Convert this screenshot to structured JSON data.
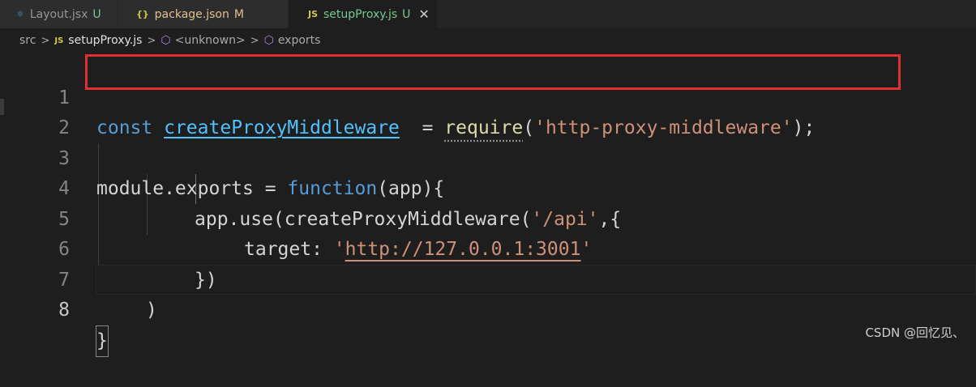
{
  "tabs": [
    {
      "icon_text": "⚛",
      "label": "Layout.jsx",
      "status": "U",
      "status_color": "#73c991"
    },
    {
      "icon_text": "{}",
      "label": "package.json",
      "status": "M",
      "status_color": "#e2c08d"
    },
    {
      "icon_text": "JS",
      "label": "setupProxy.js",
      "status": "U",
      "status_color": "#73c991",
      "active": true,
      "close": "✕"
    }
  ],
  "breadcrumb": {
    "folder": "src",
    "file_icon": "JS",
    "file": "setupProxy.js",
    "item1": "<unknown>",
    "item2": "exports"
  },
  "editor": {
    "line_numbers": [
      "1",
      "2",
      "3",
      "4",
      "5",
      "6",
      "7",
      "8"
    ],
    "current_line": "8",
    "lines": {
      "l1": {
        "kw": "const",
        "name": "createProxyMiddleware",
        "eq": "  = ",
        "req": "require",
        "open": "(",
        "str": "'http-proxy-middleware'",
        "close": ");"
      },
      "l3": {
        "mod": "module.exports = ",
        "kw": "function",
        "rest": "(app){"
      },
      "l4": {
        "pre": "app.use(createProxyMiddleware(",
        "str": "'/api'",
        "post": ",{"
      },
      "l5": {
        "key": "target: ",
        "q1": "'",
        "url": "http://127.0.0.1:3001",
        "q2": "'"
      },
      "l6": {
        "text": "})"
      },
      "l7": {
        "text": ")"
      },
      "l8": {
        "text": "}"
      }
    }
  },
  "watermark": "CSDN @回忆见、",
  "colors": {
    "highlight_box": "#e03030",
    "background": "#1e1e1e"
  }
}
